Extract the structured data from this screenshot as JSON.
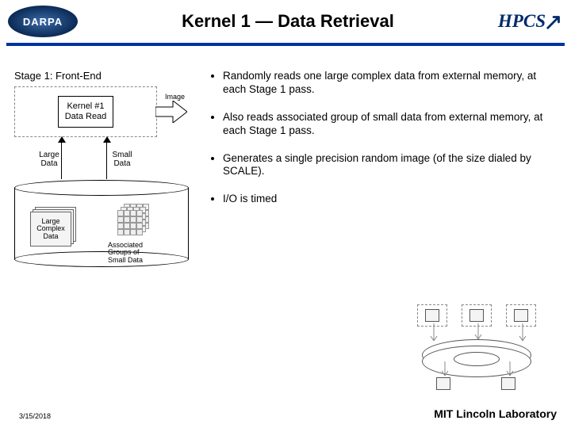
{
  "header": {
    "badge": "DARPA",
    "title": "Kernel 1 — Data Retrieval",
    "logo": "HPCS"
  },
  "left": {
    "stage_label": "Stage 1:  Front-End",
    "kernel_line1": "Kernel #1",
    "kernel_line2": "Data Read",
    "image_label": "Image",
    "large_data_l1": "Large",
    "large_data_l2": "Data",
    "small_data_l1": "Small",
    "small_data_l2": "Data",
    "sheet_l1": "Large",
    "sheet_l2": "Complex",
    "sheet_l3": "Data",
    "assoc_l1": "Associated",
    "assoc_l2": "Groups of",
    "assoc_l3": "Small Data"
  },
  "bullets": {
    "b1": "Randomly reads one large complex data from external memory, at each Stage 1 pass.",
    "b2": "Also reads associated group of small data from external memory, at each Stage 1 pass.",
    "b3": "Generates a single precision random image (of the size dialed by SCALE).",
    "b4": "I/O is timed"
  },
  "footer": {
    "lab": "MIT Lincoln Laboratory",
    "date": "3/15/2018"
  }
}
